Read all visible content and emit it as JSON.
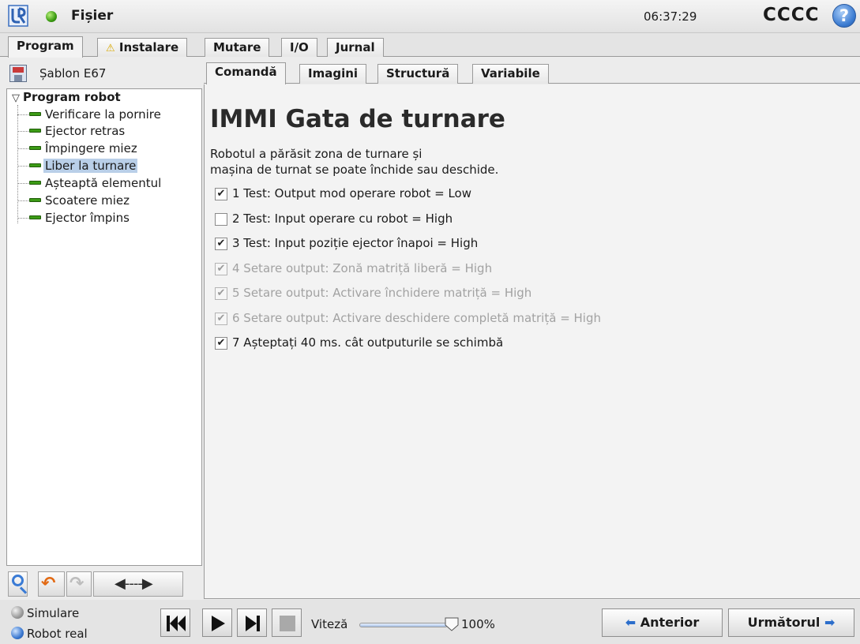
{
  "topbar": {
    "file_menu": "Fișier",
    "clock": "06:37:29",
    "robot_name": "CCCC",
    "help": "?"
  },
  "main_tabs": [
    {
      "label": "Program"
    },
    {
      "label": "Instalare"
    },
    {
      "label": "Mutare"
    },
    {
      "label": "I/O"
    },
    {
      "label": "Jurnal"
    }
  ],
  "program": {
    "file_name": "Șablon E67",
    "tree_root": "Program robot",
    "tree_items": [
      {
        "label": "Verificare la pornire"
      },
      {
        "label": "Ejector retras"
      },
      {
        "label": "Împingere miez"
      },
      {
        "label": "Liber la turnare"
      },
      {
        "label": "Așteaptă elementul"
      },
      {
        "label": "Scoatere miez"
      },
      {
        "label": "Ejector împins"
      }
    ],
    "selected_item": "Liber la turnare"
  },
  "sub_tabs": [
    {
      "label": "Comandă"
    },
    {
      "label": "Imagini"
    },
    {
      "label": "Structură"
    },
    {
      "label": "Variabile"
    }
  ],
  "content": {
    "title": "IMMI Gata de turnare",
    "desc_line1": "Robotul a părăsit zona de turnare și",
    "desc_line2": "mașina de turnat se poate închide sau deschide.",
    "checks": [
      {
        "text": "1 Test: Output mod operare robot = Low",
        "checked": true,
        "disabled": false
      },
      {
        "text": "2 Test: Input operare cu robot = High",
        "checked": false,
        "disabled": false
      },
      {
        "text": "3 Test: Input poziție ejector înapoi = High",
        "checked": true,
        "disabled": false
      },
      {
        "text": "4 Setare output: Zonă matriță liberă = High",
        "checked": true,
        "disabled": true
      },
      {
        "text": "5 Setare output: Activare închidere matriță = High",
        "checked": true,
        "disabled": true
      },
      {
        "text": "6 Setare output: Activare deschidere completă matriță = High",
        "checked": true,
        "disabled": true
      },
      {
        "text": "7 Așteptați 40 ms. cât outputurile se schimbă",
        "checked": true,
        "disabled": false
      }
    ]
  },
  "bottom": {
    "simulation_label": "Simulare",
    "real_robot_label": "Robot real",
    "speed_label": "Viteză",
    "speed_value": "100%",
    "speed_fraction": 1.0,
    "prev_label": "Anterior",
    "next_label": "Următorul"
  },
  "icons": {
    "logo": "ur-logo-icon",
    "status": "green-status-icon",
    "help": "help-icon",
    "save": "floppy-icon",
    "warning": "warning-triangle-icon",
    "check": "✔"
  }
}
